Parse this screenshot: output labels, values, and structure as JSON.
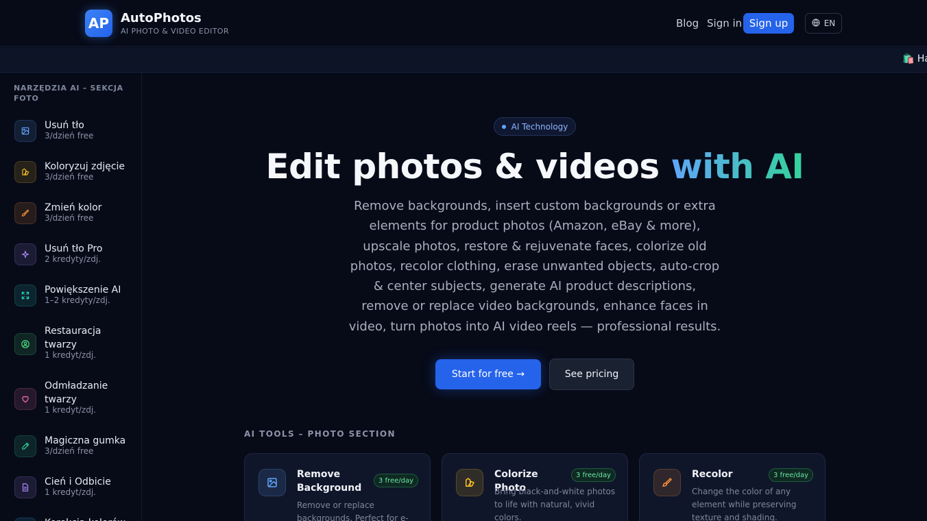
{
  "header": {
    "logo_badge": "AP",
    "brand_name": "AutoPhotos",
    "brand_sub": "AI PHOTO & VIDEO EDITOR",
    "nav_blog": "Blog",
    "nav_signin": "Sign in",
    "signup_label": "Sign up",
    "lang_label": "EN"
  },
  "marquee": {
    "text": "🛍️ Ha"
  },
  "sidebar": {
    "title": "NARZĘDZIA AI – SEKCJA FOTO",
    "items": [
      {
        "label": "Usuń tło",
        "sub": "3/dzień free",
        "icon": "image-icon",
        "color": "#60a5fa"
      },
      {
        "label": "Koloryzuj zdjęcie",
        "sub": "3/dzień free",
        "icon": "palette-icon",
        "color": "#fbbf24"
      },
      {
        "label": "Zmień kolor",
        "sub": "3/dzień free",
        "icon": "brush-icon",
        "color": "#fb923c"
      },
      {
        "label": "Usuń tło Pro",
        "sub": "2 kredyty/zdj.",
        "icon": "sparkle-icon",
        "color": "#a78bfa"
      },
      {
        "label": "Powiększenie AI",
        "sub": "1–2 kredyty/zdj.",
        "icon": "expand-icon",
        "color": "#2dd4bf"
      },
      {
        "label": "Restauracja twarzy",
        "sub": "1 kredyt/zdj.",
        "icon": "user-circle-icon",
        "color": "#4ade80"
      },
      {
        "label": "Odmładzanie twarzy",
        "sub": "1 kredyt/zdj.",
        "icon": "heart-icon",
        "color": "#f472b6"
      },
      {
        "label": "Magiczna gumka",
        "sub": "3/dzień free",
        "icon": "pencil-icon",
        "color": "#34d399"
      },
      {
        "label": "Cień i Odbicie",
        "sub": "1 kredyt/zdj.",
        "icon": "file-icon",
        "color": "#a78bfa"
      },
      {
        "label": "Korekcja kolorów",
        "sub": "",
        "icon": "adjust-icon",
        "color": "#38bdf8"
      }
    ]
  },
  "hero": {
    "pill": "AI Technology",
    "title_main": "Edit photos & videos ",
    "title_accent": "with AI",
    "description": "Remove backgrounds, insert custom backgrounds or extra elements for product photos (Amazon, eBay & more), upscale photos, restore & rejuvenate faces, colorize old photos, recolor clothing, erase unwanted objects, auto-crop & center subjects, generate AI product descriptions, remove or replace video backgrounds, enhance faces in video, turn photos into AI video reels — professional results.",
    "start_label": "Start for free →",
    "pricing_label": "See pricing"
  },
  "tools": {
    "section_title": "AI TOOLS – PHOTO SECTION",
    "cards": [
      {
        "title": "Remove Background",
        "badge": "3 free/day",
        "desc": "Remove or replace backgrounds. Perfect for e-commerce.",
        "icon": "image-icon",
        "color": "#60a5fa"
      },
      {
        "title": "Colorize Photo",
        "badge": "3 free/day",
        "desc": "Bring black-and-white photos to life with natural, vivid colors.",
        "icon": "palette-icon",
        "color": "#fbbf24"
      },
      {
        "title": "Recolor",
        "badge": "3 free/day",
        "desc": "Change the color of any element while preserving texture and shading.",
        "icon": "brush-icon",
        "color": "#fb923c"
      }
    ]
  }
}
